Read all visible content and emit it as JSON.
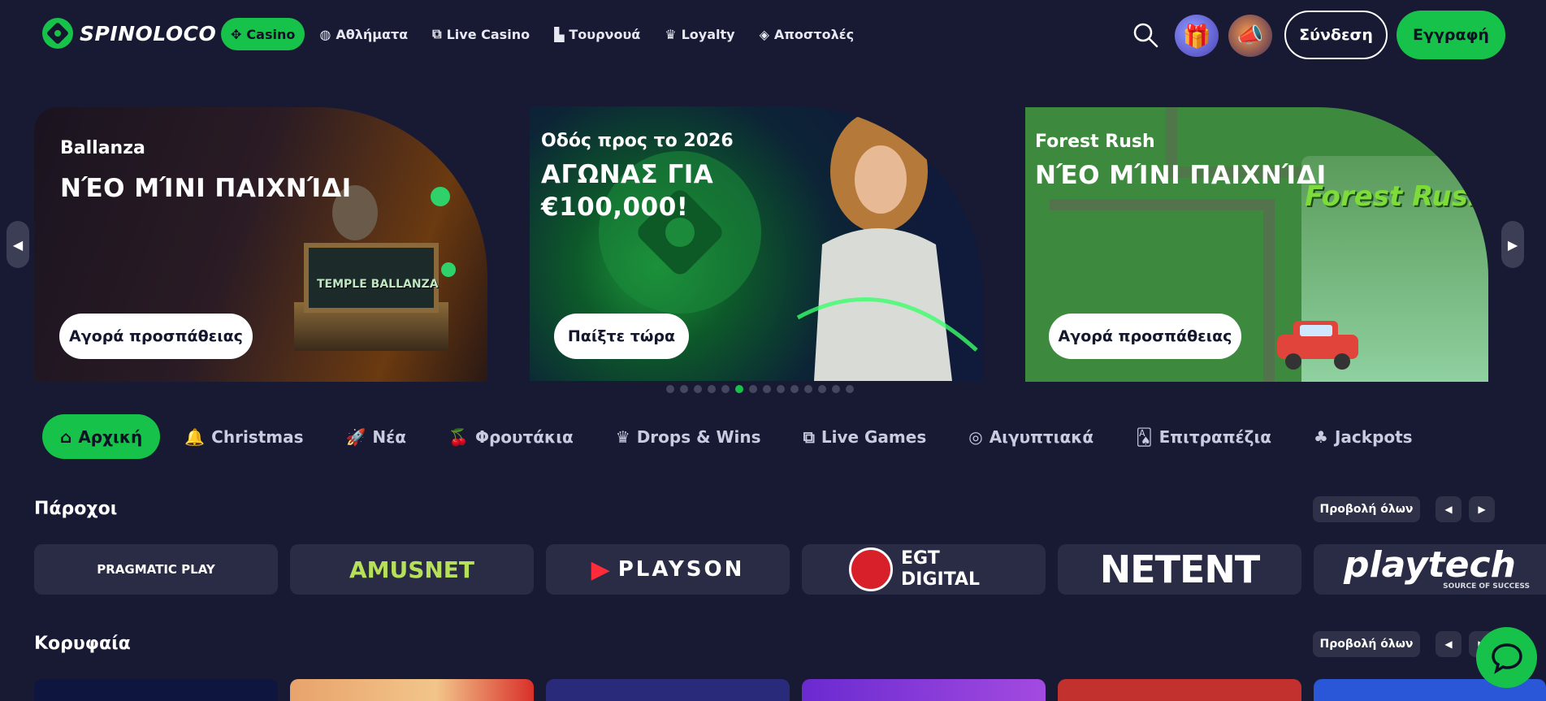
{
  "brand": {
    "name": "SPINOLOCO",
    "accent": "#17c24a",
    "background": "#181a33"
  },
  "nav": {
    "items": [
      {
        "label": "Casino",
        "icon": "casino-icon",
        "active": true
      },
      {
        "label": "Αθλήματα",
        "icon": "sports-ball-icon"
      },
      {
        "label": "Live Casino",
        "icon": "live-casino-icon"
      },
      {
        "label": "Τουρνουά",
        "icon": "tournament-icon"
      },
      {
        "label": "Loyalty",
        "icon": "crown-icon"
      },
      {
        "label": "Αποστολές",
        "icon": "missions-icon"
      }
    ]
  },
  "header": {
    "login_label": "Σύνδεση",
    "register_label": "Εγγραφή"
  },
  "banners": [
    {
      "subtitle": "Ballanza",
      "title": "ΝΈΟ ΜΊΝΙ ΠΑΙΧΝΊΔΙ",
      "cta": "Αγορά προσπάθειας",
      "art_text": "TEMPLE BALLANZA"
    },
    {
      "subtitle": "Οδός προς το 2026",
      "title": "ΑΓΩΝΑΣ ΓΙΑ €100,000!",
      "cta": "Παίξτε τώρα"
    },
    {
      "subtitle": "Forest Rush",
      "title": "ΝΈΟ ΜΊΝΙ ΠΑΙΧΝΊΔΙ",
      "cta": "Αγορά προσπάθειας",
      "art_text": "Forest Rush"
    }
  ],
  "carousel": {
    "total_slides": 14,
    "active_index": 5
  },
  "categories": [
    {
      "label": "Αρχική",
      "icon": "home-icon",
      "active": true
    },
    {
      "label": "Christmas",
      "icon": "ornament-icon"
    },
    {
      "label": "Νέα",
      "icon": "rocket-icon"
    },
    {
      "label": "Φρουτάκια",
      "icon": "cherry-icon"
    },
    {
      "label": "Drops & Wins",
      "icon": "crown-icon"
    },
    {
      "label": "Live Games",
      "icon": "live-games-icon"
    },
    {
      "label": "Αιγυπτιακά",
      "icon": "egyptian-icon"
    },
    {
      "label": "Επιτραπέζια",
      "icon": "cards-icon"
    },
    {
      "label": "Jackpots",
      "icon": "clover-icon"
    }
  ],
  "providers_section": {
    "title": "Πάροχοι",
    "view_all": "Προβολή όλων",
    "providers": [
      "PRAGMATIC PLAY",
      "AMUSNET",
      "PLAYSON",
      "EGT DIGITAL",
      "NETENT",
      "playtech"
    ],
    "playtech_tagline": "SOURCE OF SUCCESS"
  },
  "top_section": {
    "title": "Κορυφαία",
    "view_all": "Προβολή όλων"
  }
}
